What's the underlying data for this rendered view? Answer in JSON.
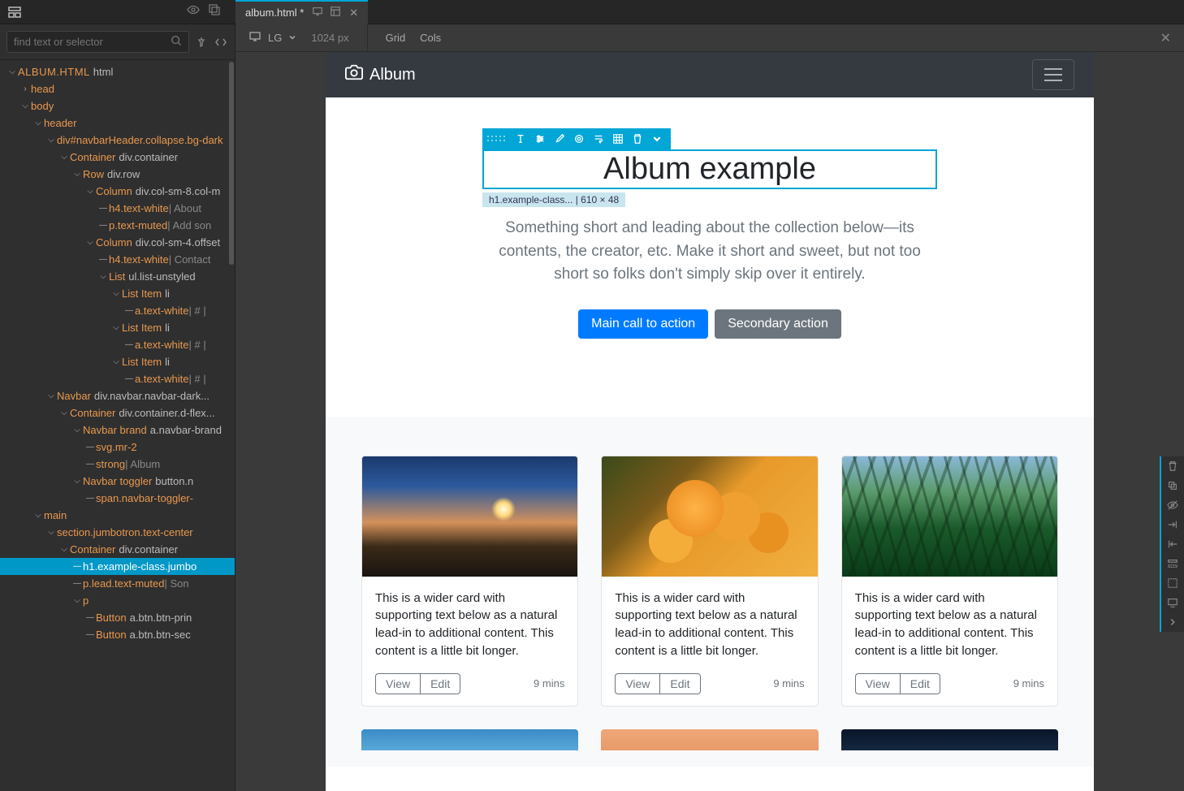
{
  "tab": {
    "title": "album.html *"
  },
  "search": {
    "placeholder": "find text or selector"
  },
  "tree": [
    {
      "depth": 0,
      "caret": "v",
      "file": "ALBUM.HTML",
      "sel": "html"
    },
    {
      "depth": 1,
      "caret": ">",
      "tag": "head"
    },
    {
      "depth": 1,
      "caret": "v",
      "tag": "body"
    },
    {
      "depth": 2,
      "caret": "v",
      "tag": "header"
    },
    {
      "depth": 3,
      "caret": "v",
      "tag": "div#navbarHeader.collapse.bg-dark"
    },
    {
      "depth": 4,
      "caret": "v",
      "tag": "Container",
      "sel": "div.container"
    },
    {
      "depth": 5,
      "caret": "v",
      "tag": "Row",
      "sel": "div.row"
    },
    {
      "depth": 6,
      "caret": "v",
      "tag": "Column",
      "sel": "div.col-sm-8.col-m"
    },
    {
      "depth": 7,
      "caret": "-",
      "tag": "h4.text-white",
      "muted": "About"
    },
    {
      "depth": 7,
      "caret": "-",
      "tag": "p.text-muted",
      "muted": "Add son"
    },
    {
      "depth": 6,
      "caret": "v",
      "tag": "Column",
      "sel": "div.col-sm-4.offset"
    },
    {
      "depth": 7,
      "caret": "-",
      "tag": "h4.text-white",
      "muted": "Contact"
    },
    {
      "depth": 7,
      "caret": "v",
      "tag": "List",
      "sel": "ul.list-unstyled"
    },
    {
      "depth": 8,
      "caret": "v",
      "tag": "List Item",
      "sel": "li"
    },
    {
      "depth": 9,
      "caret": "-",
      "tag": "a.text-white",
      "muted": "# |"
    },
    {
      "depth": 8,
      "caret": "v",
      "tag": "List Item",
      "sel": "li"
    },
    {
      "depth": 9,
      "caret": "-",
      "tag": "a.text-white",
      "muted": "# |"
    },
    {
      "depth": 8,
      "caret": "v",
      "tag": "List Item",
      "sel": "li"
    },
    {
      "depth": 9,
      "caret": "-",
      "tag": "a.text-white",
      "muted": "# |"
    },
    {
      "depth": 3,
      "caret": "v",
      "tag": "Navbar",
      "sel": "div.navbar.navbar-dark..."
    },
    {
      "depth": 4,
      "caret": "v",
      "tag": "Container",
      "sel": "div.container.d-flex..."
    },
    {
      "depth": 5,
      "caret": "v",
      "tag": "Navbar brand",
      "sel": "a.navbar-brand"
    },
    {
      "depth": 6,
      "caret": "-",
      "tag": "svg.mr-2"
    },
    {
      "depth": 6,
      "caret": "-",
      "tag": "strong",
      "muted": "Album"
    },
    {
      "depth": 5,
      "caret": "v",
      "tag": "Navbar toggler",
      "sel": "button.n"
    },
    {
      "depth": 6,
      "caret": "-",
      "tag": "span.navbar-toggler-"
    },
    {
      "depth": 2,
      "caret": "v",
      "tag": "main"
    },
    {
      "depth": 3,
      "caret": "v",
      "tag": "section.jumbotron.text-center"
    },
    {
      "depth": 4,
      "caret": "v",
      "tag": "Container",
      "sel": "div.container"
    },
    {
      "depth": 5,
      "caret": "-",
      "tag": "h1.example-class.jumbo",
      "selected": true
    },
    {
      "depth": 5,
      "caret": "-",
      "tag": "p.lead.text-muted",
      "muted": "Son"
    },
    {
      "depth": 5,
      "caret": "v",
      "tag": "p"
    },
    {
      "depth": 6,
      "caret": "-",
      "tag": "Button",
      "sel": "a.btn.btn-prin"
    },
    {
      "depth": 6,
      "caret": "-",
      "tag": "Button",
      "sel": "a.btn.btn-sec"
    }
  ],
  "canvasToolbar": {
    "breakpoint": "LG",
    "width": "1024 px",
    "grid": "Grid",
    "cols": "Cols"
  },
  "selInfo": "h1.example-class... | 610 × 48",
  "preview": {
    "brand": "Album",
    "h1": "Album example",
    "lead": "Something short and leading about the collection below—its contents, the creator, etc. Make it short and sweet, but not too short so folks don't simply skip over it entirely.",
    "btn1": "Main call to action",
    "btn2": "Secondary action",
    "cardText": "This is a wider card with supporting text below as a natural lead-in to additional content. This content is a little bit longer.",
    "view": "View",
    "edit": "Edit",
    "mins": "9 mins"
  }
}
